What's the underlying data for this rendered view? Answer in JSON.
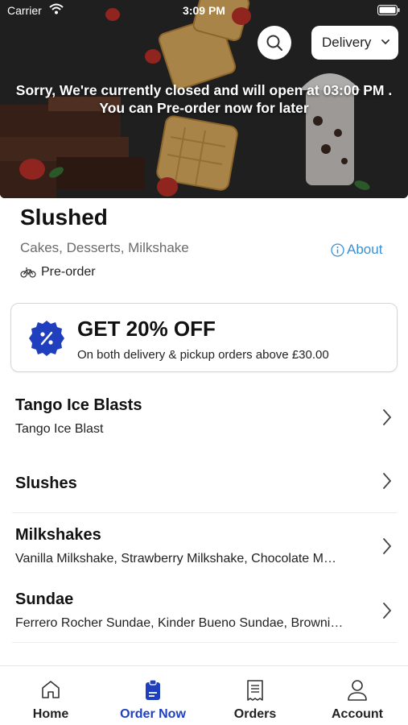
{
  "status_bar": {
    "carrier": "Carrier",
    "time": "3:09 PM"
  },
  "hero": {
    "closed_line1": "Sorry, We're currently closed and will open at 03:00 PM .",
    "closed_line2": "You can Pre-order now for later"
  },
  "header": {
    "search_icon": "search-icon",
    "order_mode": "Delivery"
  },
  "store": {
    "name": "Slushed",
    "categories": "Cakes, Desserts, Milkshake",
    "about_label": "About",
    "preorder_label": "Pre-order"
  },
  "promo": {
    "title": "GET 20% OFF",
    "subtitle": "On both delivery & pickup orders above £30.00",
    "badge_color": "#1f3fbf"
  },
  "menu_categories": [
    {
      "title": "Tango Ice Blasts",
      "items": "Tango Ice Blast"
    },
    {
      "title": "Slushes",
      "items": ""
    },
    {
      "title": "Milkshakes",
      "items": "Vanilla Milkshake, Strawberry Milkshake, Chocolate M…"
    },
    {
      "title": "Sundae",
      "items": "Ferrero Rocher Sundae, Kinder Bueno Sundae, Browni…"
    }
  ],
  "tabs": [
    {
      "label": "Home",
      "icon": "home-icon",
      "active": false
    },
    {
      "label": "Order Now",
      "icon": "order-icon",
      "active": true
    },
    {
      "label": "Orders",
      "icon": "receipt-icon",
      "active": false
    },
    {
      "label": "Account",
      "icon": "user-icon",
      "active": false
    }
  ],
  "colors": {
    "accent": "#1f3fbf",
    "link": "#3a8fd1"
  }
}
